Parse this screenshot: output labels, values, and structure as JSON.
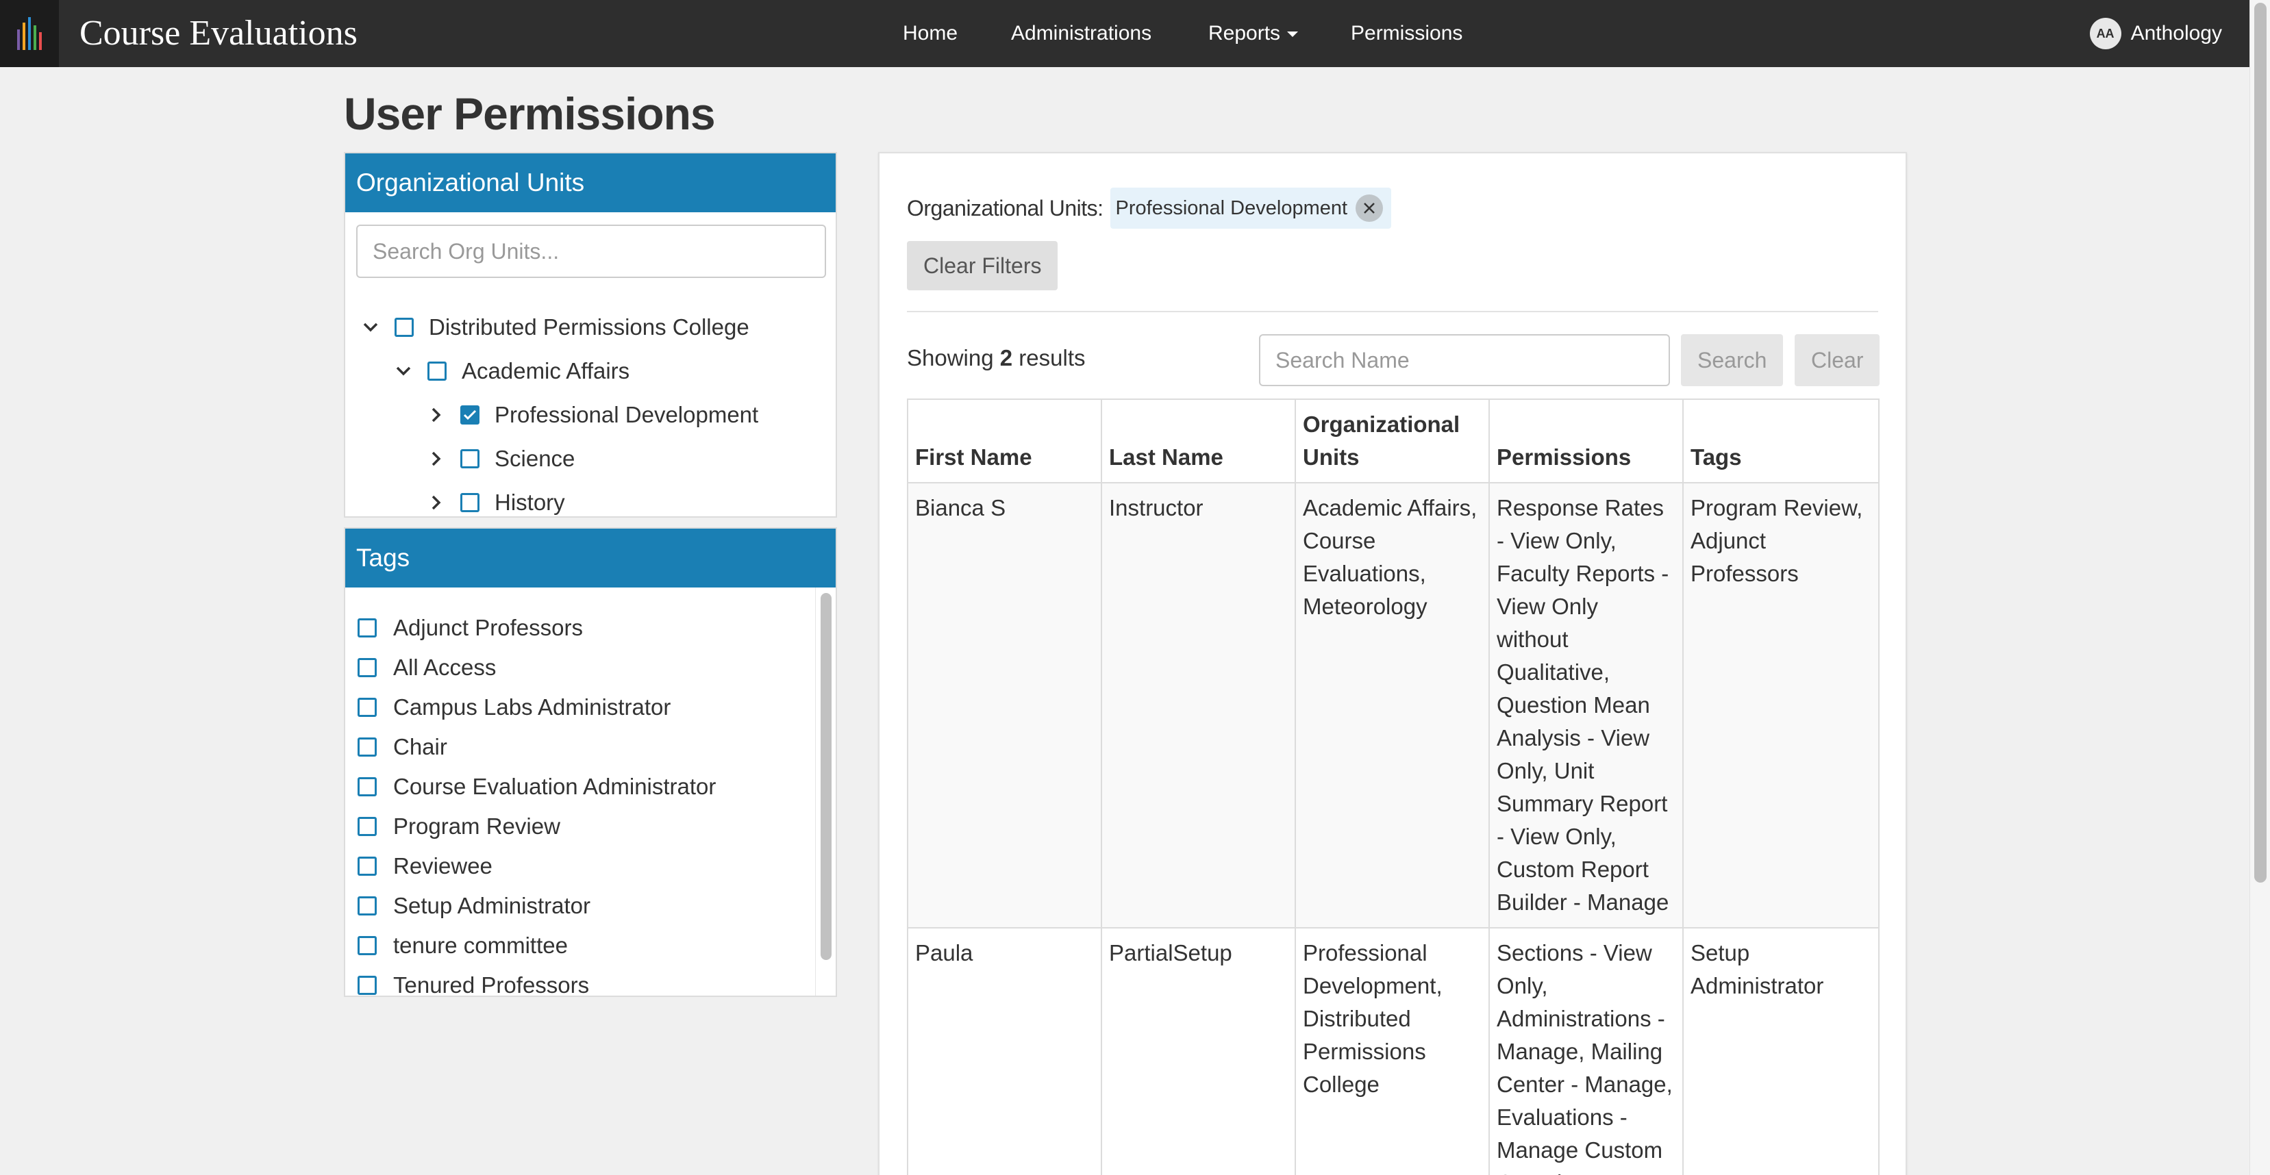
{
  "app": {
    "brand": "Course Evaluations",
    "brand_colors": [
      "#7a5ca8",
      "#f5a623",
      "#2b8fd6",
      "#4caf50",
      "#e94e4e"
    ]
  },
  "nav": {
    "items": [
      {
        "label": "Home"
      },
      {
        "label": "Administrations"
      },
      {
        "label": "Reports"
      },
      {
        "label": "Permissions"
      }
    ],
    "user": {
      "initials": "AA",
      "name": "Anthology"
    }
  },
  "page": {
    "title": "User Permissions"
  },
  "org_units": {
    "header": "Organizational Units",
    "search_placeholder": "Search Org Units...",
    "tree": [
      {
        "label": "Distributed Permissions College",
        "level": 0,
        "expanded": true,
        "checked": false
      },
      {
        "label": "Academic Affairs",
        "level": 1,
        "expanded": true,
        "checked": false
      },
      {
        "label": "Professional Development",
        "level": 2,
        "expanded": false,
        "checked": true
      },
      {
        "label": "Science",
        "level": 2,
        "expanded": false,
        "checked": false
      },
      {
        "label": "History",
        "level": 2,
        "expanded": false,
        "checked": false
      }
    ]
  },
  "tags": {
    "header": "Tags",
    "items": [
      {
        "label": "Adjunct Professors",
        "checked": false
      },
      {
        "label": "All Access",
        "checked": false
      },
      {
        "label": "Campus Labs Administrator",
        "checked": false
      },
      {
        "label": "Chair",
        "checked": false
      },
      {
        "label": "Course Evaluation Administrator",
        "checked": false
      },
      {
        "label": "Program Review",
        "checked": false
      },
      {
        "label": "Reviewee",
        "checked": false
      },
      {
        "label": "Setup Administrator",
        "checked": false
      },
      {
        "label": "tenure committee",
        "checked": false
      },
      {
        "label": "Tenured Professors",
        "checked": false
      }
    ]
  },
  "filters": {
    "label": "Organizational Units:",
    "chip": "Professional Development",
    "clear_label": "Clear Filters"
  },
  "results": {
    "showing_prefix": "Showing",
    "count": "2",
    "showing_suffix": "results",
    "search_placeholder": "Search Name",
    "search_label": "Search",
    "clear_label": "Clear",
    "columns": [
      "First Name",
      "Last Name",
      "Organizational Units",
      "Permissions",
      "Tags"
    ],
    "rows": [
      {
        "first": "Bianca S",
        "last": "Instructor",
        "org_units": "Academic Affairs, Course Evaluations, Meteorology",
        "permissions": "Response Rates - View Only, Faculty Reports - View Only without Qualitative, Question Mean Analysis - View Only, Unit Summary Report - View Only, Custom Report Builder - Manage",
        "tags": "Program Review, Adjunct Professors"
      },
      {
        "first": "Paula",
        "last": "PartialSetup",
        "org_units": "Professional Development, Distributed Permissions College",
        "permissions": "Sections - View Only, Administrations - Manage, Mailing Center - Manage, Evaluations - Manage Custom Questions, User",
        "tags": "Setup Administrator"
      }
    ]
  },
  "colors": {
    "navbar": "#2e2e2e",
    "panel_header": "#1a7fb4",
    "checkbox": "#1a7fb4",
    "chip_bg": "#e6f2fa",
    "background": "#f0f0f0"
  }
}
